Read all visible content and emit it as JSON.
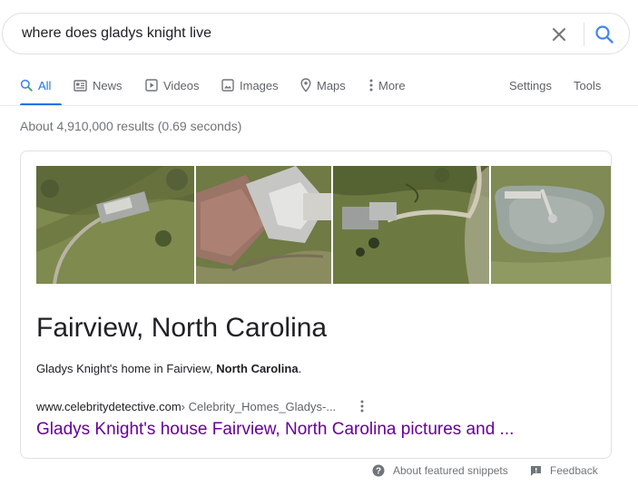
{
  "search": {
    "query": "where does gladys knight live"
  },
  "tabs": [
    {
      "label": "All",
      "icon": "search-icon",
      "active": true
    },
    {
      "label": "News",
      "icon": "news-icon"
    },
    {
      "label": "Videos",
      "icon": "video-icon"
    },
    {
      "label": "Images",
      "icon": "image-icon"
    },
    {
      "label": "Maps",
      "icon": "map-pin-icon"
    },
    {
      "label": "More",
      "icon": "more-vert-icon"
    }
  ],
  "tools": {
    "settings_label": "Settings",
    "tools_label": "Tools"
  },
  "result_stats": "About 4,910,000 results (0.69 seconds)",
  "snippet": {
    "images": [
      "aerial-house-1",
      "aerial-house-2",
      "aerial-house-3",
      "aerial-pond"
    ],
    "title": "Fairview, North Carolina",
    "description_prefix": "Gladys Knight's home in Fairview, ",
    "description_bold": "North Carolina",
    "description_suffix": ".",
    "cite_domain": "www.celebritydetective.com",
    "cite_path": " › Celebrity_Homes_Gladys-...",
    "link_text": "Gladys Knight's house Fairview, North Carolina pictures and ..."
  },
  "footer": {
    "about_label": "About featured snippets",
    "feedback_label": "Feedback"
  },
  "colors": {
    "accent": "#1a73e8",
    "visited_link": "#660099",
    "muted_text": "#70757a"
  }
}
